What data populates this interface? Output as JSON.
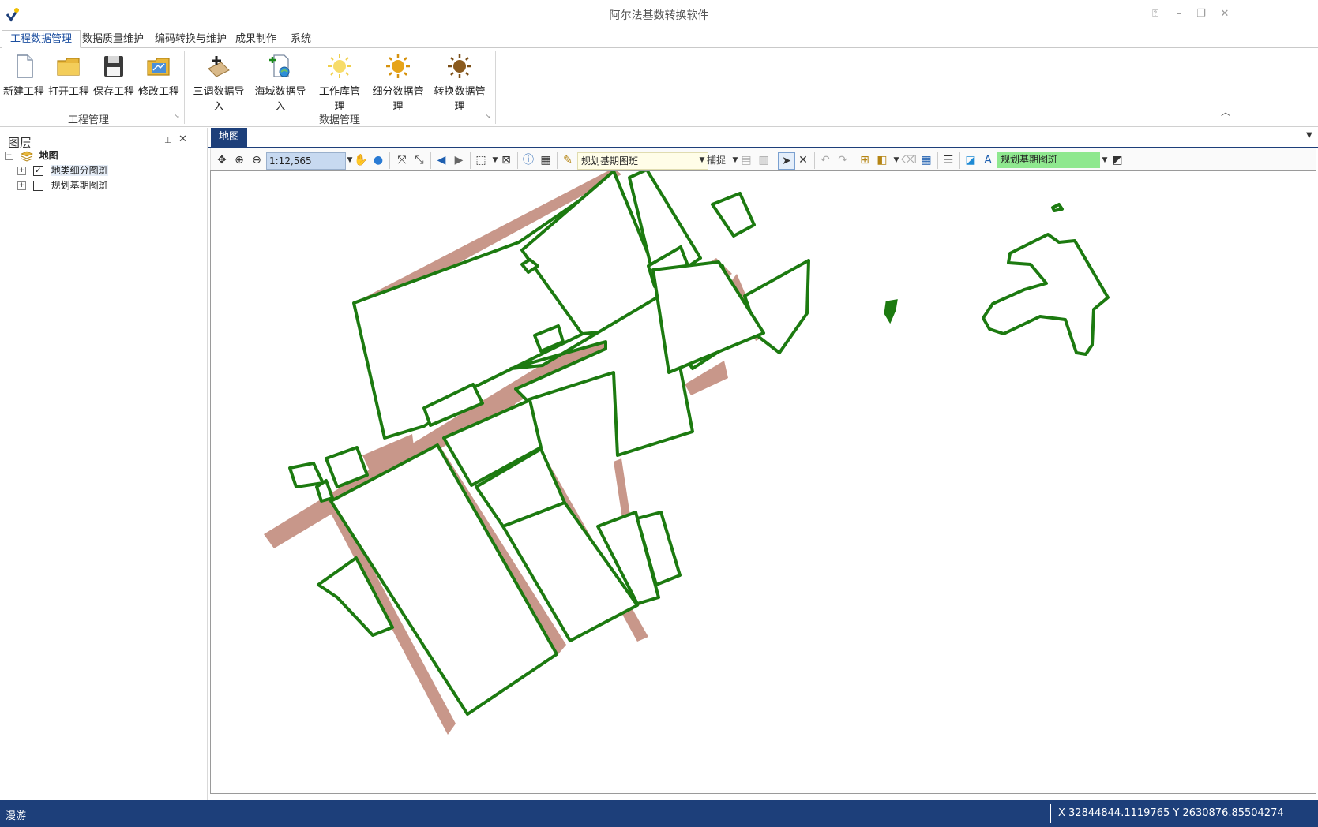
{
  "window": {
    "title": "阿尔法基数转换软件"
  },
  "ribbon": {
    "tabs": [
      "工程数据管理",
      "数据质量维护",
      "编码转换与维护",
      "成果制作",
      "系统"
    ],
    "active_tab": "工程数据管理",
    "groups": [
      {
        "label": "工程管理",
        "buttons": [
          {
            "label": "新建工程",
            "icon": "new-file-icon"
          },
          {
            "label": "打开工程",
            "icon": "open-folder-icon"
          },
          {
            "label": "保存工程",
            "icon": "save-disk-icon"
          },
          {
            "label": "修改工程",
            "icon": "edit-project-icon"
          }
        ]
      },
      {
        "label": "数据管理",
        "buttons": [
          {
            "label": "三调数据导入",
            "icon": "import-survey-icon"
          },
          {
            "label": "海域数据导入",
            "icon": "import-sea-icon"
          },
          {
            "label": "工作库管理",
            "icon": "workspace-sun-icon"
          },
          {
            "label": "细分数据管理",
            "icon": "subdivide-sun-icon"
          },
          {
            "label": "转换数据管理",
            "icon": "convert-sun-icon"
          }
        ]
      }
    ]
  },
  "layer_panel": {
    "title": "图层",
    "root": "地图",
    "layers": [
      {
        "name": "地类细分图斑",
        "checked": true
      },
      {
        "name": "规划基期图斑",
        "checked": false
      }
    ]
  },
  "map": {
    "tab": "地图",
    "scale": "1:12,565",
    "edit_layer": "规划基期图斑",
    "snap_label": "捕捉",
    "target_layer": "规划基期图斑",
    "colors": {
      "boundary": "#1c7a10",
      "road_fill": "#c8978a",
      "parcel_fill": "#ffffff",
      "accent": "#1d3f7a"
    }
  },
  "status": {
    "mode": "漫游",
    "coords": "X 32844844.1119765 Y 2630876.85504274"
  }
}
